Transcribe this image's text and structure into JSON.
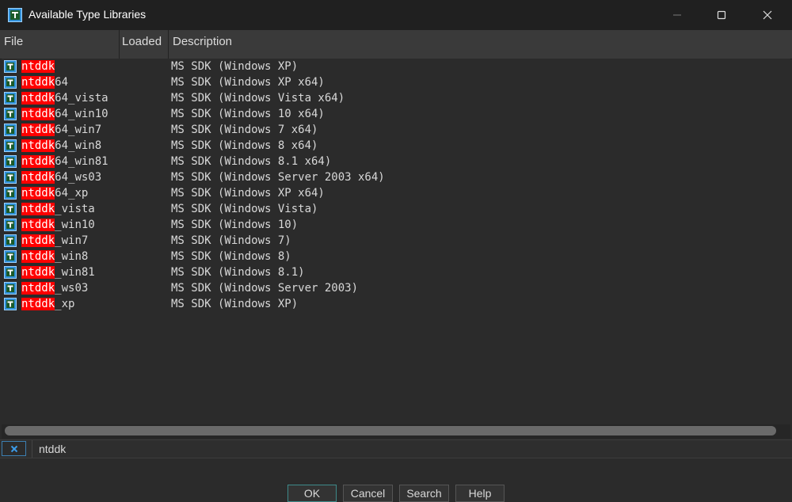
{
  "window": {
    "title": "Available Type Libraries",
    "icon": "type-library-icon"
  },
  "columns": {
    "file": "File",
    "loaded": "Loaded",
    "description": "Description"
  },
  "rows": [
    {
      "match": "ntddk",
      "rest": "",
      "description": "MS SDK (Windows XP)"
    },
    {
      "match": "ntddk",
      "rest": "64",
      "description": "MS SDK (Windows XP x64)"
    },
    {
      "match": "ntddk",
      "rest": "64_vista",
      "description": "MS SDK (Windows Vista x64)"
    },
    {
      "match": "ntddk",
      "rest": "64_win10",
      "description": "MS SDK (Windows 10 x64)"
    },
    {
      "match": "ntddk",
      "rest": "64_win7",
      "description": "MS SDK (Windows 7 x64)"
    },
    {
      "match": "ntddk",
      "rest": "64_win8",
      "description": "MS SDK (Windows 8 x64)"
    },
    {
      "match": "ntddk",
      "rest": "64_win81",
      "description": "MS SDK (Windows 8.1 x64)"
    },
    {
      "match": "ntddk",
      "rest": "64_ws03",
      "description": "MS SDK (Windows Server 2003 x64)"
    },
    {
      "match": "ntddk",
      "rest": "64_xp",
      "description": "MS SDK (Windows XP x64)"
    },
    {
      "match": "ntddk",
      "rest": "_vista",
      "description": "MS SDK (Windows Vista)"
    },
    {
      "match": "ntddk",
      "rest": "_win10",
      "description": "MS SDK (Windows 10)"
    },
    {
      "match": "ntddk",
      "rest": "_win7",
      "description": "MS SDK (Windows 7)"
    },
    {
      "match": "ntddk",
      "rest": "_win8",
      "description": "MS SDK (Windows 8)"
    },
    {
      "match": "ntddk",
      "rest": "_win81",
      "description": "MS SDK (Windows 8.1)"
    },
    {
      "match": "ntddk",
      "rest": "_ws03",
      "description": "MS SDK (Windows Server 2003)"
    },
    {
      "match": "ntddk",
      "rest": "_xp",
      "description": "MS SDK (Windows XP)"
    }
  ],
  "filter": {
    "value": "ntddk",
    "clear_icon": "close-x-icon"
  },
  "buttons": {
    "ok": "OK",
    "cancel": "Cancel",
    "search": "Search",
    "help": "Help"
  },
  "colors": {
    "highlight": "#ff0000",
    "accent": "#3c7fb1",
    "background": "#2b2b2b"
  }
}
